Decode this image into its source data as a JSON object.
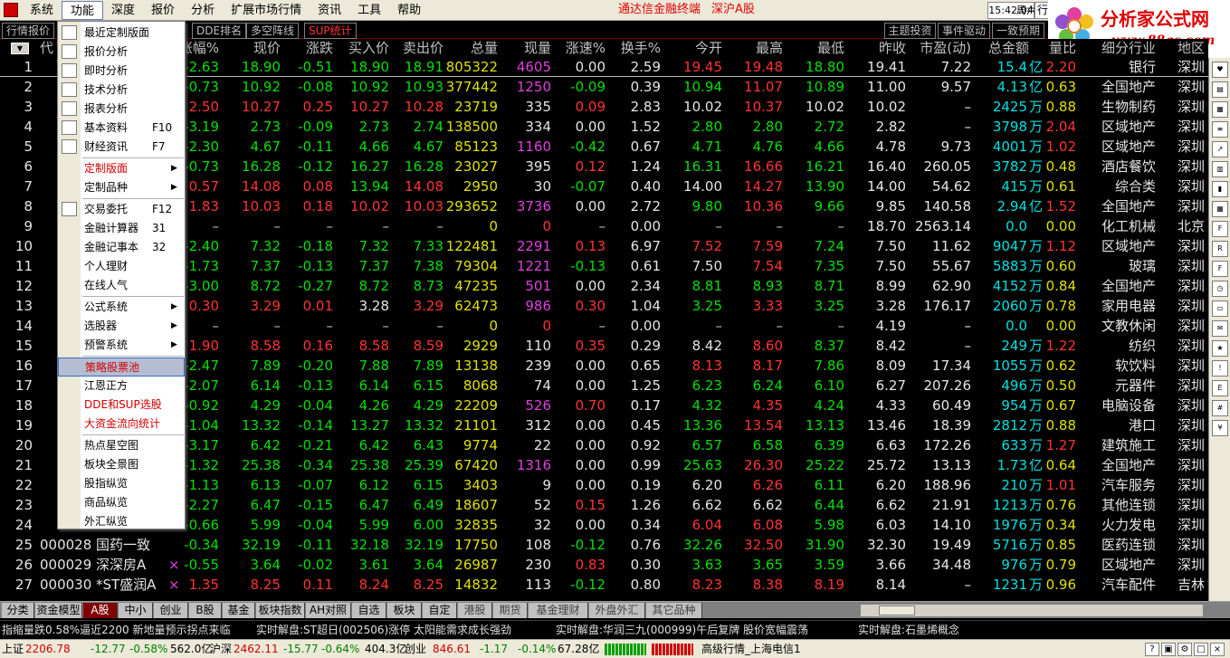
{
  "menu": {
    "items": [
      "系统",
      "功能",
      "深度",
      "报价",
      "分析",
      "扩展市场行情",
      "资讯",
      "工具",
      "帮助"
    ],
    "center_links": [
      "通达信金融终端",
      "深沪A股"
    ],
    "clock": "15:42:04",
    "weekday": "周六",
    "hang_btn": "行"
  },
  "logo": {
    "title": "分析家公式网",
    "url": "www.88gs.com"
  },
  "top_tabs": [
    "行情报价",
    "DDE排名",
    "多空阵线",
    "SUP统计"
  ],
  "right_tabs": [
    "主题投资",
    "事件驱动",
    "一致预期"
  ],
  "headers": [
    "代",
    "涨幅%",
    "现价",
    "涨跌",
    "买入价",
    "卖出价",
    "总量",
    "现量",
    "涨速%",
    "换手%",
    "今开",
    "最高",
    "最低",
    "昨收",
    "市盈(动)",
    "总金额",
    "量比",
    "细分行业",
    "地区"
  ],
  "rows": [
    {
      "no": "1",
      "code": "",
      "name": "",
      "mark": "",
      "chg_pct": "-2.63",
      "price": "18.90",
      "chg": "-0.51",
      "bid": "18.90",
      "ask": "18.91",
      "vol": "805322",
      "cur": "4605",
      "speed": "0.00",
      "turnover": "2.59",
      "open": "19.45",
      "high": "19.48",
      "low": "18.80",
      "prev": "19.41",
      "pe": "7.22",
      "amt": "15.4",
      "amt_unit": "亿",
      "vr": "2.20",
      "industry": "银行",
      "region": "深圳"
    },
    {
      "no": "2",
      "code": "",
      "name": "",
      "mark": "",
      "chg_pct": "-0.73",
      "price": "10.92",
      "chg": "-0.08",
      "bid": "10.92",
      "ask": "10.93",
      "vol": "377442",
      "cur": "1250",
      "speed": "-0.09",
      "turnover": "0.39",
      "open": "10.94",
      "high": "11.07",
      "low": "10.89",
      "prev": "11.00",
      "pe": "9.57",
      "amt": "4.13",
      "amt_unit": "亿",
      "vr": "0.63",
      "industry": "全国地产",
      "region": "深圳"
    },
    {
      "no": "3",
      "code": "",
      "name": "",
      "mark": "",
      "chg_pct": "2.50",
      "price": "10.27",
      "chg": "0.25",
      "bid": "10.27",
      "ask": "10.28",
      "vol": "23719",
      "cur": "335",
      "speed": "0.09",
      "turnover": "2.83",
      "open": "10.02",
      "high": "10.37",
      "low": "10.02",
      "prev": "10.02",
      "pe": "–",
      "amt": "2425",
      "amt_unit": "万",
      "vr": "0.88",
      "industry": "生物制药",
      "region": "深圳"
    },
    {
      "no": "4",
      "code": "",
      "name": "",
      "mark": "",
      "chg_pct": "-3.19",
      "price": "2.73",
      "chg": "-0.09",
      "bid": "2.73",
      "ask": "2.74",
      "vol": "138500",
      "cur": "334",
      "speed": "0.00",
      "turnover": "1.52",
      "open": "2.80",
      "high": "2.80",
      "low": "2.72",
      "prev": "2.82",
      "pe": "–",
      "amt": "3798",
      "amt_unit": "万",
      "vr": "2.04",
      "industry": "区域地产",
      "region": "深圳"
    },
    {
      "no": "5",
      "code": "",
      "name": "",
      "mark": "",
      "chg_pct": "-2.30",
      "price": "4.67",
      "chg": "-0.11",
      "bid": "4.66",
      "ask": "4.67",
      "vol": "85123",
      "cur": "1160",
      "speed": "-0.42",
      "turnover": "0.67",
      "open": "4.71",
      "high": "4.76",
      "low": "4.66",
      "prev": "4.78",
      "pe": "9.73",
      "amt": "4001",
      "amt_unit": "万",
      "vr": "1.02",
      "industry": "区域地产",
      "region": "深圳"
    },
    {
      "no": "6",
      "code": "",
      "name": "",
      "mark": "",
      "chg_pct": "-0.73",
      "price": "16.28",
      "chg": "-0.12",
      "bid": "16.27",
      "ask": "16.28",
      "vol": "23027",
      "cur": "395",
      "speed": "0.12",
      "turnover": "1.24",
      "open": "16.31",
      "high": "16.66",
      "low": "16.21",
      "prev": "16.40",
      "pe": "260.05",
      "amt": "3782",
      "amt_unit": "万",
      "vr": "0.48",
      "industry": "酒店餐饮",
      "region": "深圳"
    },
    {
      "no": "7",
      "code": "",
      "name": "",
      "mark": "",
      "chg_pct": "0.57",
      "price": "14.08",
      "chg": "0.08",
      "bid": "13.94",
      "ask": "14.08",
      "vol": "2950",
      "cur": "30",
      "speed": "-0.07",
      "turnover": "0.40",
      "open": "14.00",
      "high": "14.27",
      "low": "13.90",
      "prev": "14.00",
      "pe": "54.62",
      "amt": "415",
      "amt_unit": "万",
      "vr": "0.61",
      "industry": "综合类",
      "region": "深圳"
    },
    {
      "no": "8",
      "code": "",
      "name": "",
      "mark": "",
      "chg_pct": "1.83",
      "price": "10.03",
      "chg": "0.18",
      "bid": "10.02",
      "ask": "10.03",
      "vol": "293652",
      "cur": "3736",
      "speed": "0.00",
      "turnover": "2.72",
      "open": "9.80",
      "high": "10.36",
      "low": "9.66",
      "prev": "9.85",
      "pe": "140.58",
      "amt": "2.94",
      "amt_unit": "亿",
      "vr": "1.52",
      "industry": "全国地产",
      "region": "深圳"
    },
    {
      "no": "9",
      "code": "",
      "name": "",
      "mark": "",
      "chg_pct": "–",
      "price": "–",
      "chg": "–",
      "bid": "–",
      "ask": "–",
      "vol": "0",
      "cur": "0",
      "speed": "–",
      "turnover": "0.00",
      "open": "–",
      "high": "–",
      "low": "–",
      "prev": "18.70",
      "pe": "2563.14",
      "amt": "0.0",
      "amt_unit": "",
      "vr": "0.00",
      "industry": "化工机械",
      "region": "北京"
    },
    {
      "no": "10",
      "code": "",
      "name": "",
      "mark": "",
      "chg_pct": "-2.40",
      "price": "7.32",
      "chg": "-0.18",
      "bid": "7.32",
      "ask": "7.33",
      "vol": "122481",
      "cur": "2291",
      "speed": "0.13",
      "turnover": "6.97",
      "open": "7.52",
      "high": "7.59",
      "low": "7.24",
      "prev": "7.50",
      "pe": "11.62",
      "amt": "9047",
      "amt_unit": "万",
      "vr": "1.12",
      "industry": "区域地产",
      "region": "深圳"
    },
    {
      "no": "11",
      "code": "",
      "name": "",
      "mark": "",
      "chg_pct": "-1.73",
      "price": "7.37",
      "chg": "-0.13",
      "bid": "7.37",
      "ask": "7.38",
      "vol": "79304",
      "cur": "1221",
      "speed": "-0.13",
      "turnover": "0.61",
      "open": "7.50",
      "high": "7.54",
      "low": "7.35",
      "prev": "7.50",
      "pe": "55.67",
      "amt": "5883",
      "amt_unit": "万",
      "vr": "0.60",
      "industry": "玻璃",
      "region": "深圳"
    },
    {
      "no": "12",
      "code": "",
      "name": "",
      "mark": "",
      "chg_pct": "-3.00",
      "price": "8.72",
      "chg": "-0.27",
      "bid": "8.72",
      "ask": "8.73",
      "vol": "47235",
      "cur": "501",
      "speed": "0.00",
      "turnover": "2.34",
      "open": "8.81",
      "high": "8.93",
      "low": "8.71",
      "prev": "8.99",
      "pe": "62.90",
      "amt": "4152",
      "amt_unit": "万",
      "vr": "0.84",
      "industry": "全国地产",
      "region": "深圳"
    },
    {
      "no": "13",
      "code": "",
      "name": "",
      "mark": "",
      "chg_pct": "0.30",
      "price": "3.29",
      "chg": "0.01",
      "bid": "3.28",
      "ask": "3.29",
      "vol": "62473",
      "cur": "986",
      "speed": "0.30",
      "turnover": "1.04",
      "open": "3.25",
      "high": "3.33",
      "low": "3.25",
      "prev": "3.28",
      "pe": "176.17",
      "amt": "2060",
      "amt_unit": "万",
      "vr": "0.78",
      "industry": "家用电器",
      "region": "深圳"
    },
    {
      "no": "14",
      "code": "",
      "name": "",
      "mark": "",
      "chg_pct": "–",
      "price": "–",
      "chg": "–",
      "bid": "–",
      "ask": "–",
      "vol": "0",
      "cur": "0",
      "speed": "–",
      "turnover": "0.00",
      "open": "–",
      "high": "–",
      "low": "–",
      "prev": "4.19",
      "pe": "–",
      "amt": "0.0",
      "amt_unit": "",
      "vr": "0.00",
      "industry": "文教休闲",
      "region": "深圳"
    },
    {
      "no": "15",
      "code": "",
      "name": "",
      "mark": "",
      "chg_pct": "1.90",
      "price": "8.58",
      "chg": "0.16",
      "bid": "8.58",
      "ask": "8.59",
      "vol": "2929",
      "cur": "110",
      "speed": "0.35",
      "turnover": "0.29",
      "open": "8.42",
      "high": "8.60",
      "low": "8.37",
      "prev": "8.42",
      "pe": "–",
      "amt": "249",
      "amt_unit": "万",
      "vr": "1.22",
      "industry": "纺织",
      "region": "深圳"
    },
    {
      "no": "16",
      "code": "",
      "name": "",
      "mark": "",
      "chg_pct": "-2.47",
      "price": "7.89",
      "chg": "-0.20",
      "bid": "7.88",
      "ask": "7.89",
      "vol": "13138",
      "cur": "239",
      "speed": "0.00",
      "turnover": "0.65",
      "open": "8.13",
      "high": "8.17",
      "low": "7.86",
      "prev": "8.09",
      "pe": "17.34",
      "amt": "1055",
      "amt_unit": "万",
      "vr": "0.62",
      "industry": "软饮料",
      "region": "深圳"
    },
    {
      "no": "17",
      "code": "",
      "name": "",
      "mark": "",
      "chg_pct": "-2.07",
      "price": "6.14",
      "chg": "-0.13",
      "bid": "6.14",
      "ask": "6.15",
      "vol": "8068",
      "cur": "74",
      "speed": "0.00",
      "turnover": "1.25",
      "open": "6.23",
      "high": "6.24",
      "low": "6.10",
      "prev": "6.27",
      "pe": "207.26",
      "amt": "496",
      "amt_unit": "万",
      "vr": "0.50",
      "industry": "元器件",
      "region": "深圳"
    },
    {
      "no": "18",
      "code": "",
      "name": "",
      "mark": "",
      "chg_pct": "-0.92",
      "price": "4.29",
      "chg": "-0.04",
      "bid": "4.26",
      "ask": "4.29",
      "vol": "22209",
      "cur": "526",
      "speed": "0.70",
      "turnover": "0.17",
      "open": "4.32",
      "high": "4.35",
      "low": "4.24",
      "prev": "4.33",
      "pe": "60.49",
      "amt": "954",
      "amt_unit": "万",
      "vr": "0.67",
      "industry": "电脑设备",
      "region": "深圳"
    },
    {
      "no": "19",
      "code": "",
      "name": "",
      "mark": "",
      "chg_pct": "-1.04",
      "price": "13.32",
      "chg": "-0.14",
      "bid": "13.27",
      "ask": "13.32",
      "vol": "21101",
      "cur": "312",
      "speed": "0.00",
      "turnover": "0.45",
      "open": "13.36",
      "high": "13.54",
      "low": "13.13",
      "prev": "13.46",
      "pe": "18.39",
      "amt": "2812",
      "amt_unit": "万",
      "vr": "0.88",
      "industry": "港口",
      "region": "深圳"
    },
    {
      "no": "20",
      "code": "",
      "name": "",
      "mark": "",
      "chg_pct": "-3.17",
      "price": "6.42",
      "chg": "-0.21",
      "bid": "6.42",
      "ask": "6.43",
      "vol": "9774",
      "cur": "22",
      "speed": "0.00",
      "turnover": "0.92",
      "open": "6.57",
      "high": "6.58",
      "low": "6.39",
      "prev": "6.63",
      "pe": "172.26",
      "amt": "633",
      "amt_unit": "万",
      "vr": "1.27",
      "industry": "建筑施工",
      "region": "深圳"
    },
    {
      "no": "21",
      "code": "",
      "name": "",
      "mark": "",
      "chg_pct": "-1.32",
      "price": "25.38",
      "chg": "-0.34",
      "bid": "25.38",
      "ask": "25.39",
      "vol": "67420",
      "cur": "1316",
      "speed": "0.00",
      "turnover": "0.99",
      "open": "25.63",
      "high": "26.30",
      "low": "25.22",
      "prev": "25.72",
      "pe": "13.13",
      "amt": "1.73",
      "amt_unit": "亿",
      "vr": "0.64",
      "industry": "全国地产",
      "region": "深圳"
    },
    {
      "no": "22",
      "code": "",
      "name": "",
      "mark": "",
      "chg_pct": "-1.13",
      "price": "6.13",
      "chg": "-0.07",
      "bid": "6.12",
      "ask": "6.15",
      "vol": "3403",
      "cur": "9",
      "speed": "0.00",
      "turnover": "0.19",
      "open": "6.20",
      "high": "6.26",
      "low": "6.11",
      "prev": "6.20",
      "pe": "188.96",
      "amt": "210",
      "amt_unit": "万",
      "vr": "1.01",
      "industry": "汽车服务",
      "region": "深圳"
    },
    {
      "no": "23",
      "code": "",
      "name": "",
      "mark": "",
      "chg_pct": "-2.27",
      "price": "6.47",
      "chg": "-0.15",
      "bid": "6.47",
      "ask": "6.49",
      "vol": "18607",
      "cur": "52",
      "speed": "0.15",
      "turnover": "1.26",
      "open": "6.62",
      "high": "6.62",
      "low": "6.44",
      "prev": "6.62",
      "pe": "21.91",
      "amt": "1213",
      "amt_unit": "万",
      "vr": "0.76",
      "industry": "其他连锁",
      "region": "深圳"
    },
    {
      "no": "24",
      "code": "",
      "name": "",
      "mark": "",
      "chg_pct": "-0.66",
      "price": "5.99",
      "chg": "-0.04",
      "bid": "5.99",
      "ask": "6.00",
      "vol": "32835",
      "cur": "32",
      "speed": "0.00",
      "turnover": "0.34",
      "open": "6.04",
      "high": "6.08",
      "low": "5.98",
      "prev": "6.03",
      "pe": "14.10",
      "amt": "1976",
      "amt_unit": "万",
      "vr": "0.34",
      "industry": "火力发电",
      "region": "深圳"
    },
    {
      "no": "25",
      "code": "000028",
      "name": "国药一致",
      "mark": "",
      "chg_pct": "-0.34",
      "price": "32.19",
      "chg": "-0.11",
      "bid": "32.18",
      "ask": "32.19",
      "vol": "17750",
      "cur": "108",
      "speed": "-0.12",
      "turnover": "0.76",
      "open": "32.26",
      "high": "32.50",
      "low": "31.90",
      "prev": "32.30",
      "pe": "19.49",
      "amt": "5716",
      "amt_unit": "万",
      "vr": "0.85",
      "industry": "医药连锁",
      "region": "深圳"
    },
    {
      "no": "26",
      "code": "000029",
      "name": "深深房A",
      "mark": "×",
      "chg_pct": "-0.55",
      "price": "3.64",
      "chg": "-0.02",
      "bid": "3.61",
      "ask": "3.64",
      "vol": "26987",
      "cur": "230",
      "speed": "0.83",
      "turnover": "0.30",
      "open": "3.63",
      "high": "3.65",
      "low": "3.59",
      "prev": "3.66",
      "pe": "34.48",
      "amt": "976",
      "amt_unit": "万",
      "vr": "0.79",
      "industry": "区域地产",
      "region": "深圳"
    },
    {
      "no": "27",
      "code": "000030",
      "name": "*ST盛润A",
      "mark": "×",
      "chg_pct": "1.35",
      "price": "8.25",
      "chg": "0.11",
      "bid": "8.24",
      "ask": "8.25",
      "vol": "14832",
      "cur": "113",
      "speed": "-0.12",
      "turnover": "0.80",
      "open": "8.23",
      "high": "8.38",
      "low": "8.19",
      "prev": "8.14",
      "pe": "–",
      "amt": "1231",
      "amt_unit": "万",
      "vr": "0.96",
      "industry": "汽车配件",
      "region": "吉林"
    }
  ],
  "dropdown": {
    "items": [
      {
        "label": "最近定制版面",
        "shortcut": "",
        "arrow": false,
        "red": false,
        "icon": "layout-icon"
      },
      {
        "label": "报价分析",
        "shortcut": "",
        "arrow": false,
        "red": false,
        "icon": "grid-icon"
      },
      {
        "label": "即时分析",
        "shortcut": "",
        "arrow": false,
        "red": false,
        "icon": "line-chart-icon"
      },
      {
        "label": "技术分析",
        "shortcut": "",
        "arrow": false,
        "red": false,
        "icon": "candlestick-icon"
      },
      {
        "label": "报表分析",
        "shortcut": "",
        "arrow": false,
        "red": false,
        "icon": "report-icon"
      },
      {
        "label": "基本资料",
        "shortcut": "F10",
        "arrow": false,
        "red": false,
        "icon": "f10-icon"
      },
      {
        "label": "财经资讯",
        "shortcut": "F7",
        "arrow": false,
        "red": false,
        "icon": "news-icon"
      },
      {
        "label": "定制版面",
        "shortcut": "",
        "arrow": true,
        "red": true,
        "icon": ""
      },
      {
        "label": "定制品种",
        "shortcut": "",
        "arrow": true,
        "red": false,
        "icon": ""
      },
      {
        "label": "交易委托",
        "shortcut": "F12",
        "arrow": false,
        "red": false,
        "icon": "f12-icon"
      },
      {
        "label": "金融计算器",
        "shortcut": "31",
        "arrow": false,
        "red": false,
        "icon": ""
      },
      {
        "label": "金融记事本",
        "shortcut": "32",
        "arrow": false,
        "red": false,
        "icon": ""
      },
      {
        "label": "个人理财",
        "shortcut": "",
        "arrow": false,
        "red": false,
        "icon": ""
      },
      {
        "label": "在线人气",
        "shortcut": "",
        "arrow": false,
        "red": false,
        "icon": ""
      },
      {
        "label": "公式系统",
        "shortcut": "",
        "arrow": true,
        "red": false,
        "icon": ""
      },
      {
        "label": "选股器",
        "shortcut": "",
        "arrow": true,
        "red": false,
        "icon": ""
      },
      {
        "label": "预警系统",
        "shortcut": "",
        "arrow": true,
        "red": false,
        "icon": ""
      },
      {
        "label": "策略股票池",
        "shortcut": "",
        "arrow": false,
        "red": true,
        "icon": ""
      },
      {
        "label": "江恩正方",
        "shortcut": "",
        "arrow": false,
        "red": false,
        "icon": ""
      },
      {
        "label": "DDE和SUP选股",
        "shortcut": "",
        "arrow": false,
        "red": true,
        "icon": ""
      },
      {
        "label": "大资金流向统计",
        "shortcut": "",
        "arrow": false,
        "red": true,
        "icon": ""
      },
      {
        "label": "热点星空图",
        "shortcut": "",
        "arrow": false,
        "red": false,
        "icon": ""
      },
      {
        "label": "板块全景图",
        "shortcut": "",
        "arrow": false,
        "red": false,
        "icon": ""
      },
      {
        "label": "股指纵览",
        "shortcut": "",
        "arrow": false,
        "red": false,
        "icon": ""
      },
      {
        "label": "商品纵览",
        "shortcut": "",
        "arrow": false,
        "red": false,
        "icon": ""
      },
      {
        "label": "外汇纵览",
        "shortcut": "",
        "arrow": false,
        "red": false,
        "icon": ""
      }
    ],
    "highlighted": "策略股票池"
  },
  "bottom_tabs": [
    "分类",
    "资金模型",
    "A股",
    "中小",
    "创业",
    "B股",
    "基金",
    "板块指数",
    "AH对照",
    "自选",
    "板块",
    "自定",
    "港股",
    "期货",
    "基金理财",
    "外盘外汇",
    "其它品种"
  ],
  "ticker": [
    {
      "label": "",
      "text": "指缩量跌0.58%逼近2200 新地量预示拐点来临"
    },
    {
      "label": "实时解盘:",
      "text": "ST超日(002506)涨停 太阳能需求成长强劲"
    },
    {
      "label": "实时解盘:",
      "text": "华润三九(000999)午后复牌 股价宽幅震荡"
    },
    {
      "label": "实时解盘:",
      "text": "石墨烯概念"
    }
  ],
  "status": {
    "sh_label": "上证",
    "sh_value": "2206.78",
    "sh_chg": "-12.77",
    "sh_pct": "-0.58%",
    "sh_amt": "562.0亿",
    "sz_label": "沪深",
    "sz_value": "2462.11",
    "sz_chg": "-15.77",
    "sz_pct": "-0.64%",
    "sz_amt": "404.3亿",
    "cy_label": "创业",
    "cy_value": "846.61",
    "cy_chg": "-1.17",
    "cy_pct": "-0.14%",
    "cy_amt": "67.28亿",
    "feed": "高级行情_上海电信1"
  }
}
